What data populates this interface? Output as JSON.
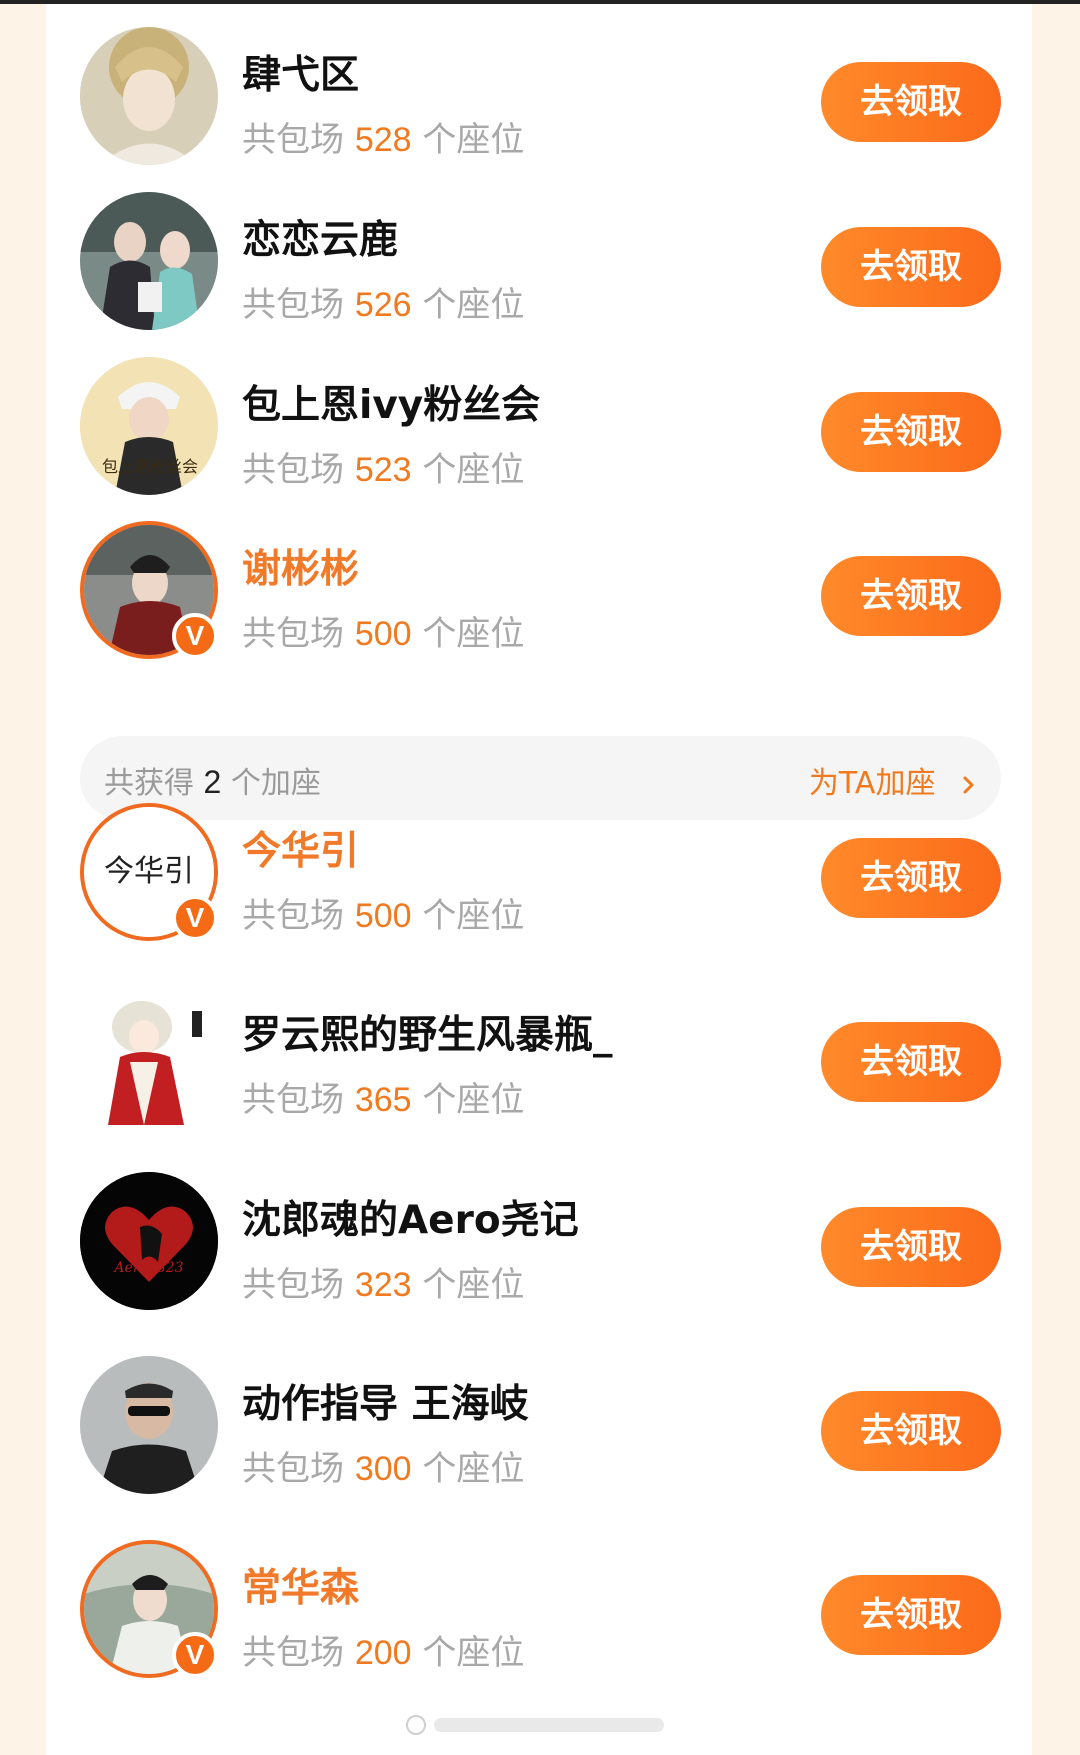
{
  "colors": {
    "accent": "#f56a14",
    "button_gradient_start": "#ff8a2a",
    "button_gradient_end": "#fb6a1a",
    "seat_number": "#f07a20",
    "page_background": "#fdf3e6"
  },
  "list": {
    "seat_prefix": "共包场",
    "seat_suffix": "个座位",
    "button_label": "去领取",
    "items": [
      {
        "name": "肆弋区",
        "seats": "528",
        "verified": false
      },
      {
        "name": "恋恋云鹿",
        "seats": "526",
        "verified": false
      },
      {
        "name": "包上恩ivy粉丝会",
        "seats": "523",
        "verified": false
      },
      {
        "name": "谢彬彬",
        "seats": "500",
        "verified": true
      },
      {
        "name": "今华引",
        "seats": "500",
        "verified": true
      },
      {
        "name": "罗云熙的野生风暴瓶_",
        "seats": "365",
        "verified": false
      },
      {
        "name": "沈郎魂的Aero尧记",
        "seats": "323",
        "verified": false
      },
      {
        "name": "动作指导 王海岐",
        "seats": "300",
        "verified": false
      },
      {
        "name": "常华森",
        "seats": "200",
        "verified": true
      }
    ]
  },
  "bonus_bar": {
    "prefix": "共获得",
    "count": "2",
    "suffix": "个加座",
    "action_label": "为TA加座",
    "action_icon": "chevron-right-icon"
  },
  "avatar_texts": {
    "jinhuayin": "今华引",
    "aero": "Aero0323",
    "baoshangen": "包上恩粉丝会"
  },
  "badge_letter": "V"
}
